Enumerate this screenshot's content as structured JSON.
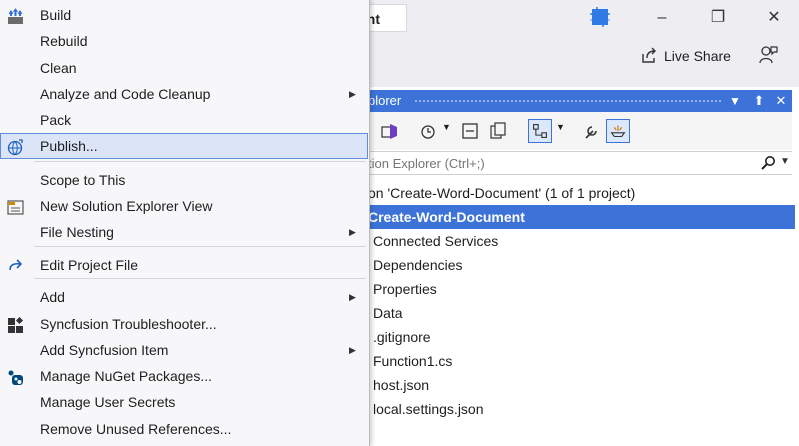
{
  "window": {
    "tab_partial": "ent",
    "live_share": "Live Share"
  },
  "solution_explorer": {
    "header_title": "plorer",
    "pin": "→",
    "search_placeholder": "tion Explorer (Ctrl+;)",
    "tree": [
      {
        "label": "on 'Create-Word-Document' (1 of 1 project)",
        "selected": false
      },
      {
        "label": "Create-Word-Document",
        "selected": true
      },
      {
        "label": "Connected Services",
        "selected": false
      },
      {
        "label": "Dependencies",
        "selected": false
      },
      {
        "label": "Properties",
        "selected": false
      },
      {
        "label": "Data",
        "selected": false
      },
      {
        "label": ".gitignore",
        "selected": false
      },
      {
        "label": "Function1.cs",
        "selected": false
      },
      {
        "label": "host.json",
        "selected": false
      },
      {
        "label": "local.settings.json",
        "selected": false
      }
    ]
  },
  "context_menu": {
    "items": [
      {
        "label": "Build",
        "icon": "build-icon"
      },
      {
        "label": "Rebuild"
      },
      {
        "label": "Clean"
      },
      {
        "label": "Analyze and Code Cleanup",
        "submenu": true
      },
      {
        "label": "Pack"
      },
      {
        "label": "Publish...",
        "icon": "globe-icon",
        "highlighted": true
      },
      {
        "label": "Scope to This"
      },
      {
        "label": "New Solution Explorer View",
        "icon": "new-view-icon"
      },
      {
        "label": "File Nesting",
        "submenu": true
      },
      {
        "label": "Edit Project File",
        "icon": "redo-arrow-icon"
      },
      {
        "label": "Add",
        "submenu": true
      },
      {
        "label": "Syncfusion Troubleshooter...",
        "icon": "syncfusion-icon"
      },
      {
        "label": "Add Syncfusion Item",
        "submenu": true
      },
      {
        "label": "Manage NuGet Packages...",
        "icon": "nuget-icon"
      },
      {
        "label": "Manage User Secrets"
      },
      {
        "label": "Remove Unused References..."
      }
    ]
  },
  "colors": {
    "accent": "#3d73d8",
    "menu_highlight": "#dbe5f7",
    "menu_background": "#f7f7f9"
  }
}
